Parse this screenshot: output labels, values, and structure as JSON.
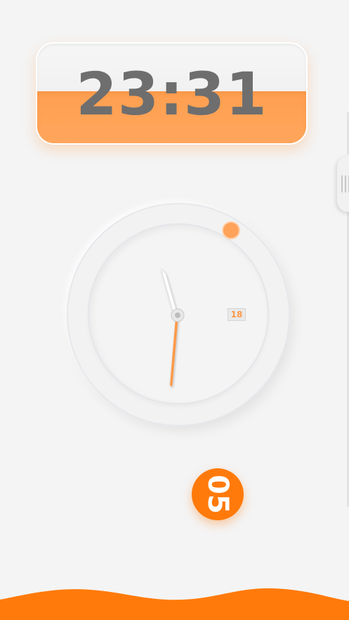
{
  "digital_clock": {
    "time": "23:31",
    "fill_fraction": 0.52
  },
  "analog_clock": {
    "hour": 11,
    "minute": 31,
    "date": "18"
  },
  "badge": {
    "text": "05"
  },
  "colors": {
    "accent": "#ff7a0a",
    "accent_light": "#ffa25a",
    "digits": "#6e6e6e",
    "background": "#f4f4f4"
  }
}
